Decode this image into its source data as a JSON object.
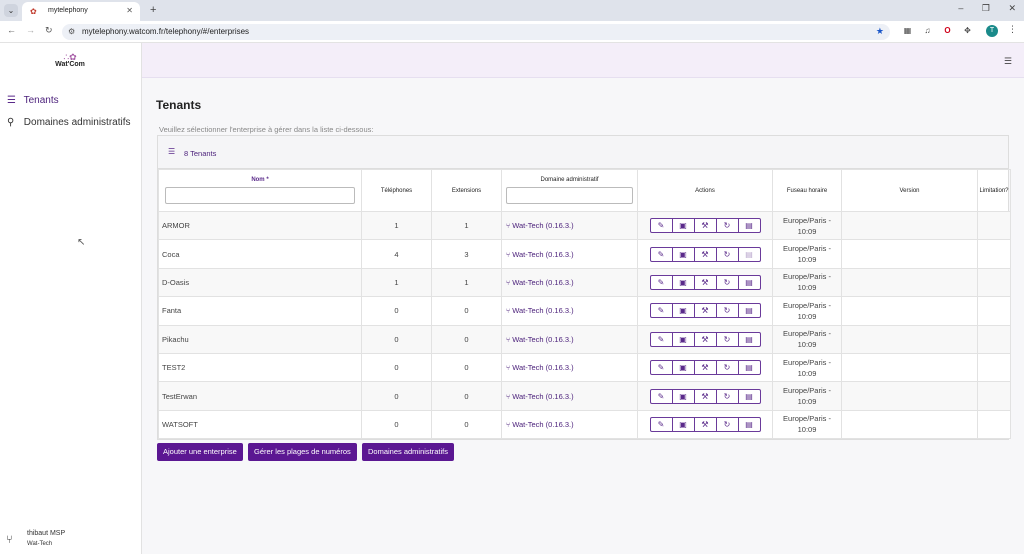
{
  "browser": {
    "tab_title": "mytelephony",
    "tab_close": "✕",
    "new_tab": "+",
    "url": "mytelephony.watcom.fr/telephony/#/enterprises",
    "profile_initial": "T"
  },
  "sidebar": {
    "logo_text": "Wat'Com",
    "items": [
      {
        "label": "Tenants",
        "icon": "list-icon"
      },
      {
        "label": "Domaines administratifs",
        "icon": "hierarchy-icon"
      }
    ],
    "user": {
      "name": "thibaut MSP",
      "org": "Wat-Tech"
    }
  },
  "main": {
    "title": "Tenants",
    "instructions": "Veuillez sélectionner l'enterprise à gérer dans la liste ci-dessous:",
    "tenant_count": "8 Tenants"
  },
  "table": {
    "columns": {
      "name": "Nom",
      "name_sort_indicator": "*",
      "phones": "Téléphones",
      "extensions": "Extensions",
      "domain": "Domaine administratif",
      "actions": "Actions",
      "timezone": "Fuseau horaire",
      "version": "Version",
      "limitation": "Limitation?"
    },
    "rows": [
      {
        "name": "ARMOR",
        "phones": "1",
        "extensions": "1",
        "domain": "Wat-Tech (0.16.3.)",
        "tz": "Europe/Paris -",
        "time": "10:09"
      },
      {
        "name": "Coca",
        "phones": "4",
        "extensions": "3",
        "domain": "Wat-Tech (0.16.3.)",
        "tz": "Europe/Paris -",
        "time": "10:09"
      },
      {
        "name": "D-Oasis",
        "phones": "1",
        "extensions": "1",
        "domain": "Wat-Tech (0.16.3.)",
        "tz": "Europe/Paris -",
        "time": "10:09"
      },
      {
        "name": "Fanta",
        "phones": "0",
        "extensions": "0",
        "domain": "Wat-Tech (0.16.3.)",
        "tz": "Europe/Paris -",
        "time": "10:09"
      },
      {
        "name": "Pikachu",
        "phones": "0",
        "extensions": "0",
        "domain": "Wat-Tech (0.16.3.)",
        "tz": "Europe/Paris -",
        "time": "10:09"
      },
      {
        "name": "TEST2",
        "phones": "0",
        "extensions": "0",
        "domain": "Wat-Tech (0.16.3.)",
        "tz": "Europe/Paris -",
        "time": "10:09"
      },
      {
        "name": "TestErwan",
        "phones": "0",
        "extensions": "0",
        "domain": "Wat-Tech (0.16.3.)",
        "tz": "Europe/Paris -",
        "time": "10:09"
      },
      {
        "name": "WATSOFT",
        "phones": "0",
        "extensions": "0",
        "domain": "Wat-Tech (0.16.3.)",
        "tz": "Europe/Paris -",
        "time": "10:09"
      }
    ],
    "row_actions": [
      "edit-icon",
      "calendar-icon",
      "wrench-icon",
      "refresh-icon",
      "export-icon"
    ]
  },
  "buttons": {
    "add_enterprise": "Ajouter une enterprise",
    "manage_ranges": "Gérer les plages de numéros",
    "admin_domains": "Domaines administratifs"
  },
  "colors": {
    "accent": "#5b1792",
    "header_bg": "#f4eef9",
    "link": "#4a1f7a"
  }
}
